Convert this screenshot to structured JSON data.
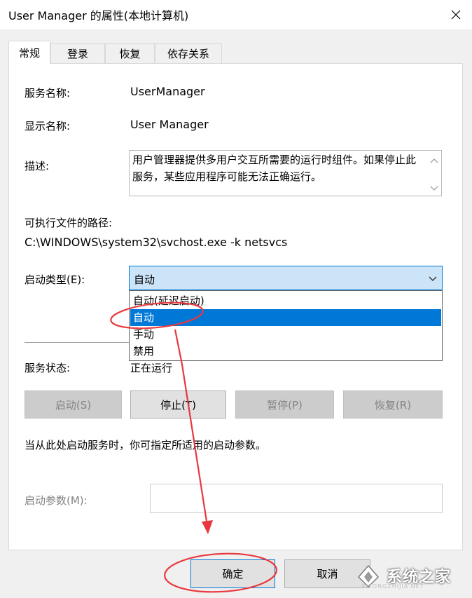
{
  "window": {
    "title": "User Manager 的属性(本地计算机)"
  },
  "tabs": [
    {
      "label": "常规",
      "active": true
    },
    {
      "label": "登录",
      "active": false
    },
    {
      "label": "恢复",
      "active": false
    },
    {
      "label": "依存关系",
      "active": false
    }
  ],
  "general": {
    "service_name_label": "服务名称:",
    "service_name": "UserManager",
    "display_name_label": "显示名称:",
    "display_name": "User Manager",
    "description_label": "描述:",
    "description": "用户管理器提供多用户交互所需要的运行时组件。如果停止此服务，某些应用程序可能无法正确运行。",
    "exe_path_label": "可执行文件的路径:",
    "exe_path": "C:\\WINDOWS\\system32\\svchost.exe -k netsvcs",
    "startup_type_label": "启动类型(E):",
    "startup_type_value": "自动",
    "startup_options": [
      "自动(延迟启动)",
      "自动",
      "手动",
      "禁用"
    ],
    "startup_selected_index": 1,
    "service_status_label": "服务状态:",
    "service_status": "正在运行",
    "buttons": {
      "start": "启动(S)",
      "stop": "停止(T)",
      "pause": "暂停(P)",
      "resume": "恢复(R)"
    },
    "hint": "当从此处启动服务时，你可指定所适用的启动参数。",
    "start_params_label": "启动参数(M):",
    "start_params_value": ""
  },
  "footer": {
    "ok": "确定",
    "cancel": "取消"
  },
  "watermark": {
    "text": "系统之家",
    "sub": "XITONGZHIJIA.NET"
  },
  "colors": {
    "accent": "#0078d7",
    "annotation": "#e8383d"
  },
  "icons": {
    "close": "close-icon",
    "chevron": "chevron-down-icon"
  }
}
